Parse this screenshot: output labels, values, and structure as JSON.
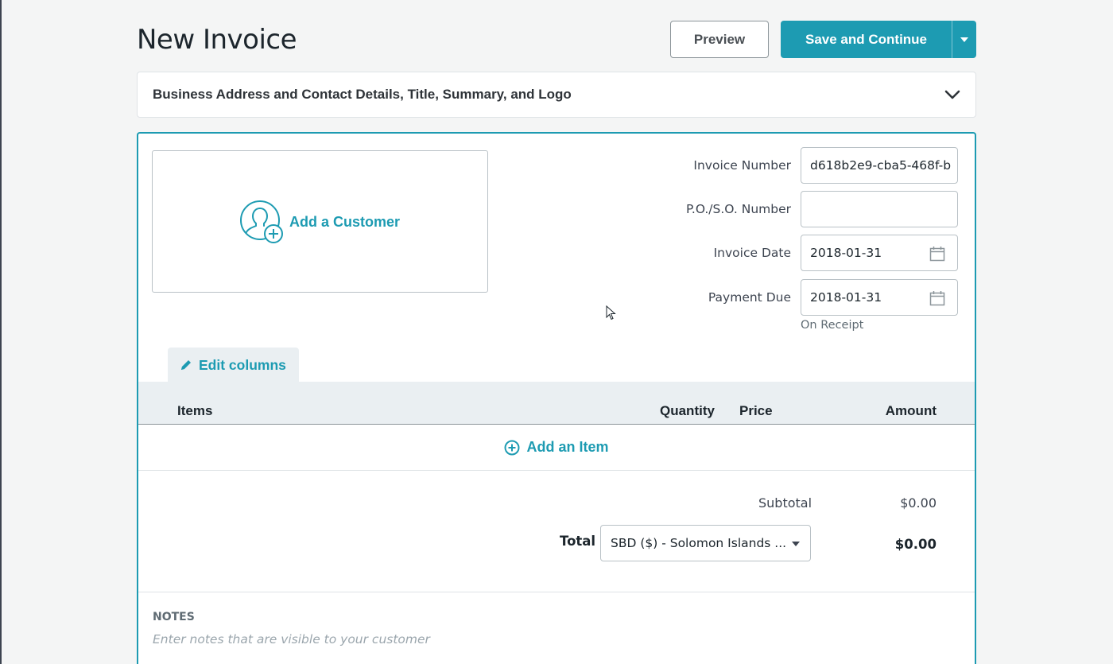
{
  "header": {
    "title": "New Invoice",
    "preview_label": "Preview",
    "save_label": "Save and Continue"
  },
  "business_panel": {
    "label": "Business Address and Contact Details, Title, Summary, and Logo"
  },
  "customer": {
    "add_label": "Add a Customer"
  },
  "fields": {
    "invoice_number": {
      "label": "Invoice Number",
      "value": "d618b2e9-cba5-468f-b"
    },
    "po_number": {
      "label": "P.O./S.O. Number",
      "value": ""
    },
    "invoice_date": {
      "label": "Invoice Date",
      "value": "2018-01-31"
    },
    "payment_due": {
      "label": "Payment Due",
      "value": "2018-01-31",
      "hint": "On Receipt"
    }
  },
  "items": {
    "edit_columns_label": "Edit columns",
    "columns": {
      "items": "Items",
      "quantity": "Quantity",
      "price": "Price",
      "amount": "Amount"
    },
    "add_item_label": "Add an Item"
  },
  "totals": {
    "subtotal_label": "Subtotal",
    "subtotal_value": "$0.00",
    "total_label": "Total",
    "currency": "SBD ($) - Solomon Islands ...",
    "total_value": "$0.00"
  },
  "notes": {
    "label": "NOTES",
    "placeholder": "Enter notes that are visible to your customer"
  },
  "colors": {
    "accent": "#1d9bb2",
    "background": "#f4f5f5",
    "table_header": "#eaeff2"
  },
  "icons": [
    "chevron-down-icon",
    "user-add-icon",
    "calendar-icon",
    "pencil-icon",
    "plus-circle-icon",
    "caret-down-icon",
    "mouse-cursor-icon"
  ]
}
